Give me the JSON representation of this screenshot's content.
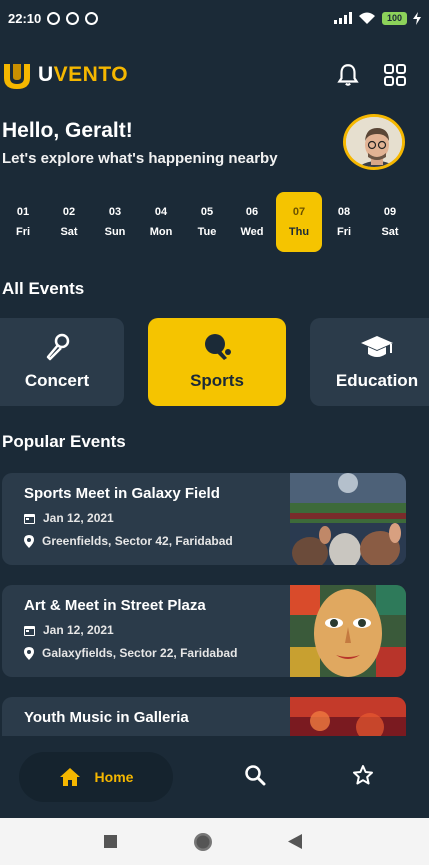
{
  "status_bar": {
    "time": "22:10",
    "battery": "100"
  },
  "app": {
    "logo_prefix": "U",
    "logo_rest": "VENTO"
  },
  "header": {
    "icons": [
      "bell-icon",
      "grid-icon"
    ]
  },
  "greeting": {
    "title": "Hello, Geralt!",
    "subtitle": "Let's explore what's happening nearby"
  },
  "dates": [
    {
      "num": "01",
      "day": "Fri"
    },
    {
      "num": "02",
      "day": "Sat"
    },
    {
      "num": "03",
      "day": "Sun"
    },
    {
      "num": "04",
      "day": "Mon"
    },
    {
      "num": "05",
      "day": "Tue"
    },
    {
      "num": "06",
      "day": "Wed"
    },
    {
      "num": "07",
      "day": "Thu",
      "selected": true
    },
    {
      "num": "08",
      "day": "Fri"
    },
    {
      "num": "09",
      "day": "Sat"
    }
  ],
  "sections": {
    "all_events": "All Events",
    "popular_events": "Popular Events"
  },
  "categories": [
    {
      "label": "Concert",
      "icon": "microphone-icon"
    },
    {
      "label": "Sports",
      "icon": "table-tennis-icon",
      "selected": true
    },
    {
      "label": "Education",
      "icon": "graduation-cap-icon"
    }
  ],
  "events": [
    {
      "title": "Sports Meet in Galaxy Field",
      "date": "Jan 12, 2021",
      "location": "Greenfields, Sector 42, Faridabad"
    },
    {
      "title": "Art & Meet in Street Plaza",
      "date": "Jan 12, 2021",
      "location": "Galaxyfields, Sector 22, Faridabad"
    },
    {
      "title": "Youth Music in Galleria",
      "date": "",
      "location": ""
    }
  ],
  "bottom_nav": {
    "home_label": "Home",
    "icons": [
      "home-icon",
      "search-icon",
      "star-icon"
    ]
  },
  "colors": {
    "background": "#1b2a37",
    "card": "#2b3b4a",
    "accent": "#f5c400"
  }
}
